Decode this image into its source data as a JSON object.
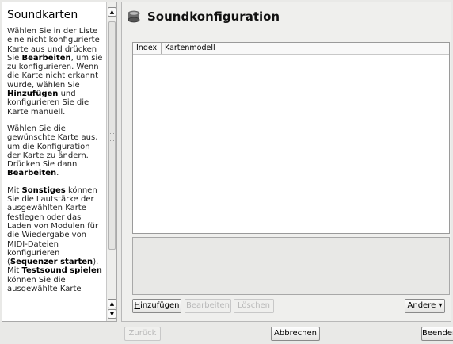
{
  "help": {
    "title": "Soundkarten",
    "p1": [
      {
        "t": "Wählen Sie in der Liste eine nicht konfigurierte Karte aus und drücken Sie ",
        "b": false
      },
      {
        "t": "Bearbeiten",
        "b": true
      },
      {
        "t": ", um sie zu konfigurieren. Wenn die Karte nicht erkannt wurde, wählen Sie ",
        "b": false
      },
      {
        "t": "Hinzufügen",
        "b": true
      },
      {
        "t": " und konfigurieren Sie die Karte manuell.",
        "b": false
      }
    ],
    "p2": [
      {
        "t": "Wählen Sie die gewünschte Karte aus, um die Konfiguration der Karte zu ändern. Drücken Sie dann ",
        "b": false
      },
      {
        "t": "Bearbeiten",
        "b": true
      },
      {
        "t": ".",
        "b": false
      }
    ],
    "p3": [
      {
        "t": "Mit ",
        "b": false
      },
      {
        "t": "Sonstiges",
        "b": true
      },
      {
        "t": " können Sie die Lautstärke der ausgewählten Karte festlegen oder das Laden von Modulen für die Wiedergabe von MIDI-Dateien konfigurieren (",
        "b": false
      },
      {
        "t": "Sequenzer starten",
        "b": true
      },
      {
        "t": "). Mit ",
        "b": false
      },
      {
        "t": "Testsound spielen",
        "b": true
      },
      {
        "t": " können Sie die ausgewählte Karte",
        "b": false
      }
    ]
  },
  "main": {
    "title": "Soundkonfiguration",
    "icon": "sound-card-icon",
    "columns": [
      "Index",
      "Kartenmodell"
    ]
  },
  "buttons": {
    "add": "Hinzufügen",
    "add_mnemonic": "H",
    "edit": "Bearbeiten",
    "delete": "Löschen",
    "other": "Andere",
    "back": "Zurück",
    "cancel": "Abbrechen",
    "finish": "Beenden"
  },
  "colors": {
    "window_bg": "#e9e9e7",
    "disabled_text": "#b8b8b8"
  }
}
